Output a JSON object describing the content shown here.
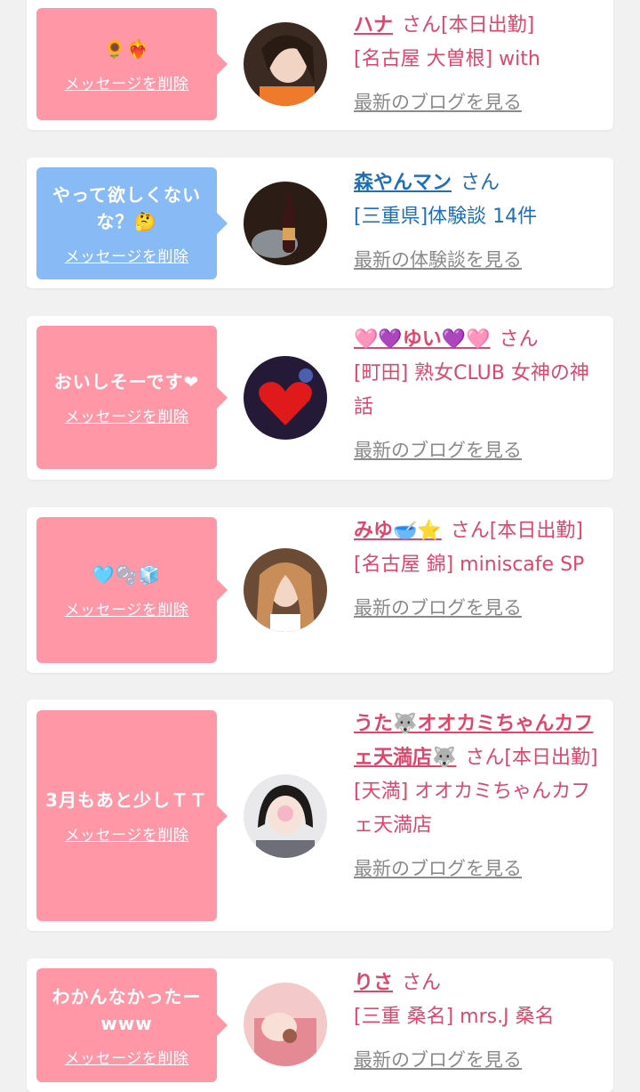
{
  "colors": {
    "pink_bubble": "#ff97a7",
    "blue_bubble": "#88baf6",
    "name_pink": "#e0466b",
    "name_blue": "#1f6fb8",
    "link_gray": "#8a8a8a"
  },
  "posts": [
    {
      "message": "🌻❤️‍🔥",
      "delete_label": "メッセージを削除",
      "name": "ハナ",
      "suffix": "さん[本日出勤]",
      "shop": "[名古屋 大曽根] with",
      "more_label": "最新のブログを見る",
      "bubble": "pink"
    },
    {
      "message": "やって欲しくないな？🤔",
      "delete_label": "メッセージを削除",
      "name": "森やんマン",
      "suffix": "さん",
      "shop": "[三重県]体験談 14件",
      "more_label": "最新の体験談を見る",
      "bubble": "blue"
    },
    {
      "message": "おいしそーです❤",
      "delete_label": "メッセージを削除",
      "name": "🩷💜ゆい💜🩷",
      "suffix": "さん",
      "shop": "[町田] 熟女CLUB 女神の神話",
      "more_label": "最新のブログを見る",
      "bubble": "pink"
    },
    {
      "message": "🩵🫧🧊",
      "delete_label": "メッセージを削除",
      "name": "みゆ🥣⭐",
      "suffix": "さん[本日出勤]",
      "shop": "[名古屋 錦] miniscafe SP",
      "more_label": "最新のブログを見る",
      "bubble": "pink"
    },
    {
      "message": "3月もあと少しＴＴ",
      "delete_label": "メッセージを削除",
      "name": "うた🐺オオカミちゃんカフェ天満店🐺",
      "suffix": "さん[本日出勤]",
      "shop": "[天満] オオカミちゃんカフェ天満店",
      "more_label": "最新のブログを見る",
      "bubble": "pink"
    },
    {
      "message": "わかんなかったーwww",
      "delete_label": "メッセージを削除",
      "name": "りさ",
      "suffix": "さん",
      "shop": "[三重 桑名] mrs.J 桑名",
      "more_label": "最新のブログを見る",
      "bubble": "pink"
    }
  ]
}
